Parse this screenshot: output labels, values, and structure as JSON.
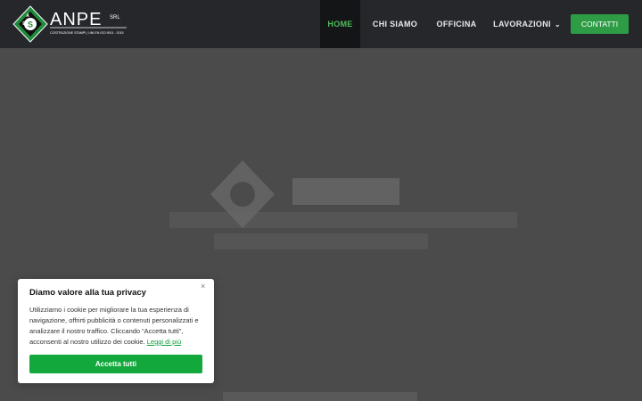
{
  "logo": {
    "brand": "ANPE",
    "suffix": "SRL",
    "tagline": "COSTRUZIONE STAMPI | UNI EN ISO 9001 : 2015"
  },
  "nav": {
    "home": "HOME",
    "chi_siamo": "CHI SIAMO",
    "officina": "OFFICINA",
    "lavorazioni": "LAVORAZIONI",
    "contatti": "CONTATTI"
  },
  "cookie": {
    "title": "Diamo valore alla tua privacy",
    "close_glyph": "×",
    "text": "Utilizziamo i cookie per migliorare la tua esperienza di navigazione, offrirti pubblicità o contenuti personalizzati e analizzare il nostro traffico. Cliccando “Accetta tutti”, acconsenti al nostro utilizzo dei cookie. ",
    "link": "Leggi di più",
    "accept": "Accetta tutti"
  },
  "colors": {
    "navbar": "#26272b",
    "active_nav": "#4ebd5c",
    "contatti_bg": "#2e9c45",
    "accept_bg": "#12a83c",
    "overlay": "#4b4b4b"
  }
}
